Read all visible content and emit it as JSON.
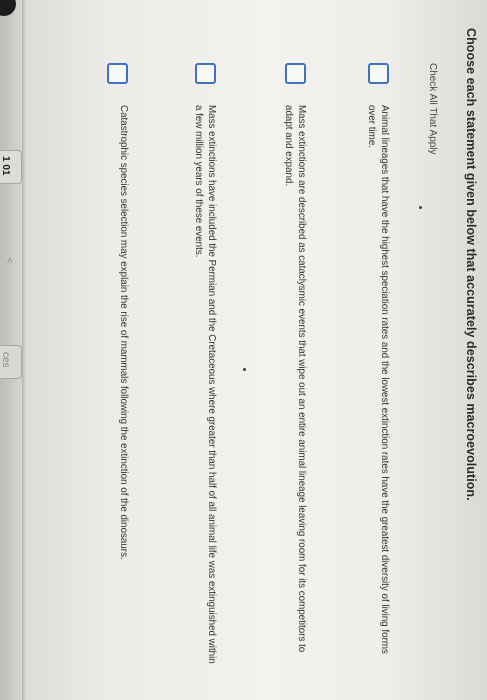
{
  "sidebar": {
    "tab_label": "1 01",
    "tab_label_2": "ces",
    "arrow_glyph": "<"
  },
  "question": {
    "title": "Choose each statement given below that accurately describes macroevolution.",
    "hint": "Check All That Apply"
  },
  "options": [
    {
      "text": "Animal lineages that have the highest speciation rates and the lowest extinction rates have the greatest diversity of living forms over time.",
      "checked": false
    },
    {
      "text": "Mass extinctions are described as cataclysmic events that wipe out an entire animal lineage leaving room for its competitors to adapt and expand.",
      "checked": false
    },
    {
      "text": "Mass extinctions have included the Permian and the Cretaceous where greater than half of all animal life was extinguished within a few million years of these events.",
      "checked": false
    },
    {
      "text": "Catastrophic species selection may explain the rise of mammals following the extinction of the dinosaurs.",
      "checked": false
    }
  ],
  "colors": {
    "checkbox_border": "#3f71c4",
    "text": "#333333"
  }
}
